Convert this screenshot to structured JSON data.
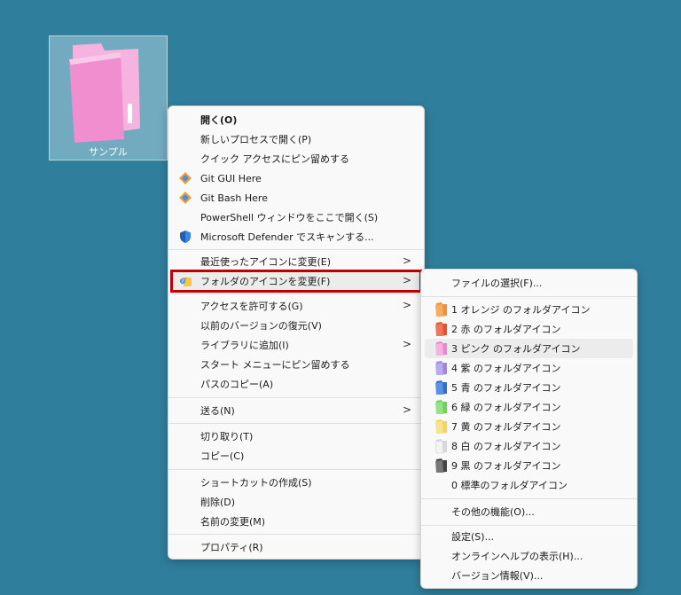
{
  "desktop": {
    "folder_label": "サンプル",
    "folder_color": "#f08ed0"
  },
  "main_menu": {
    "items": [
      {
        "label": "開く(O)",
        "icon": ""
      },
      {
        "label": "新しいプロセスで開く(P)",
        "icon": ""
      },
      {
        "label": "クイック アクセスにピン留めする",
        "icon": ""
      },
      {
        "label": "Git GUI Here",
        "icon": "git-icon"
      },
      {
        "label": "Git Bash Here",
        "icon": "git-icon"
      },
      {
        "label": "PowerShell ウィンドウをここで開く(S)",
        "icon": ""
      },
      {
        "label": "Microsoft Defender でスキャンする...",
        "icon": "defender-shield-icon"
      },
      {
        "label": "最近使ったアイコンに変更(E)",
        "icon": "",
        "submenu": true
      },
      {
        "label": "フォルダのアイコンを変更(F)",
        "icon": "folder-change-icon",
        "submenu": true
      },
      {
        "label": "アクセスを許可する(G)",
        "icon": "",
        "submenu": true
      },
      {
        "label": "以前のバージョンの復元(V)",
        "icon": ""
      },
      {
        "label": "ライブラリに追加(I)",
        "icon": "",
        "submenu": true
      },
      {
        "label": "スタート メニューにピン留めする",
        "icon": ""
      },
      {
        "label": "パスのコピー(A)",
        "icon": ""
      },
      {
        "label": "送る(N)",
        "icon": "",
        "submenu": true
      },
      {
        "label": "切り取り(T)",
        "icon": ""
      },
      {
        "label": "コピー(C)",
        "icon": ""
      },
      {
        "label": "ショートカットの作成(S)",
        "icon": ""
      },
      {
        "label": "削除(D)",
        "icon": ""
      },
      {
        "label": "名前の変更(M)",
        "icon": ""
      },
      {
        "label": "プロパティ(R)",
        "icon": ""
      }
    ],
    "submenu_arrow": ">"
  },
  "sub_menu": {
    "items": [
      {
        "label": "ファイルの選択(F)..."
      },
      {
        "label": "1 オレンジ のフォルダアイコン",
        "color": "#f0913a"
      },
      {
        "label": "2 赤 のフォルダアイコン",
        "color": "#e8502e"
      },
      {
        "label": "3 ピンク のフォルダアイコン",
        "color": "#ee86cc"
      },
      {
        "label": "4 紫 のフォルダアイコン",
        "color": "#9e86e0"
      },
      {
        "label": "5 青 のフォルダアイコン",
        "color": "#2f6fd0"
      },
      {
        "label": "6 緑 のフォルダアイコン",
        "color": "#6fd05a"
      },
      {
        "label": "7 黄 のフォルダアイコン",
        "color": "#f5d35a"
      },
      {
        "label": "8 白 のフォルダアイコン",
        "color": "#eeeeee"
      },
      {
        "label": "9 黒 のフォルダアイコン",
        "color": "#555555"
      },
      {
        "label": "0 標準のフォルダアイコン"
      },
      {
        "label": "その他の機能(O)..."
      },
      {
        "label": "設定(S)..."
      },
      {
        "label": "オンラインヘルプの表示(H)..."
      },
      {
        "label": "バージョン情報(V)..."
      }
    ]
  }
}
